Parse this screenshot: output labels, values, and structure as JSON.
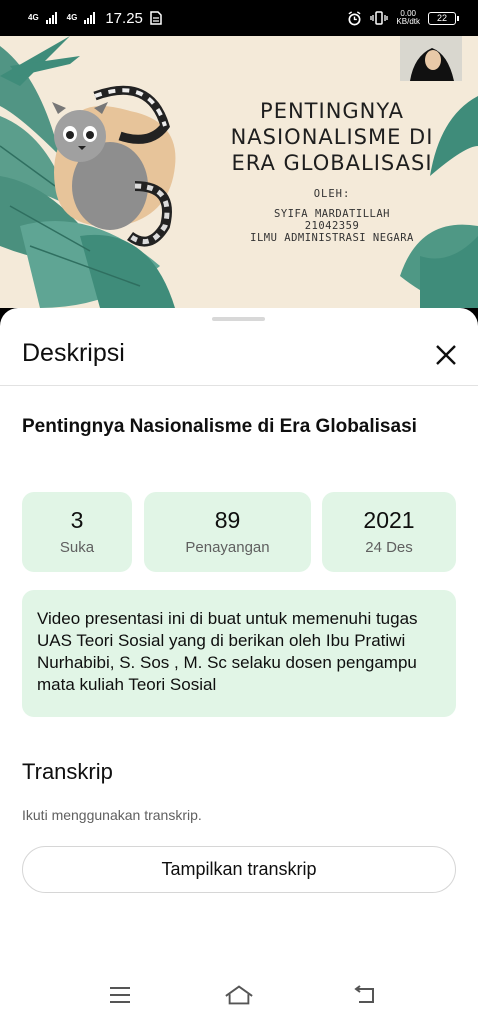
{
  "status_bar": {
    "network_1": "4G",
    "network_2": "4G",
    "time": "17.25",
    "speed_value": "0.00",
    "speed_unit": "KB/dtk",
    "battery": "22"
  },
  "video": {
    "slide_title": "PENTINGNYA NASIONALISME DI ERA GLOBALISASI",
    "slide_by": "OLEH:",
    "slide_author_name": "SYIFA MARDATILLAH",
    "slide_author_id": "21042359",
    "slide_author_program": "ILMU ADMINISTRASI NEGARA"
  },
  "sheet": {
    "header_title": "Deskripsi",
    "video_title": "Pentingnya Nasionalisme di Era Globalisasi",
    "stats": [
      {
        "value": "3",
        "label": "Suka"
      },
      {
        "value": "89",
        "label": "Penayangan"
      },
      {
        "value": "2021",
        "label": "24 Des"
      }
    ],
    "description": "Video presentasi ini di buat untuk memenuhi tugas UAS Teori Sosial yang di berikan oleh Ibu Pratiwi Nurhabibi, S. Sos , M. Sc selaku dosen pengampu mata kuliah Teori Sosial",
    "transcript_title": "Transkrip",
    "transcript_subtitle": "Ikuti menggunakan transkrip.",
    "transcript_button": "Tampilkan transkrip"
  },
  "colors": {
    "stat_bg": "#e1f5e6",
    "video_bg": "#f4ead9",
    "leaf_green": "#3f8c7a"
  }
}
